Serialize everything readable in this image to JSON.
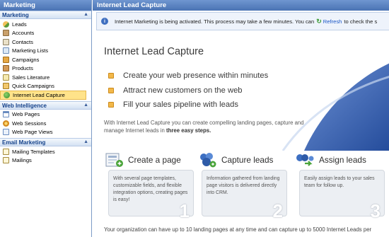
{
  "sidebar": {
    "title": "Marketing",
    "sections": [
      {
        "header": "Marketing",
        "items": [
          {
            "label": "Leads",
            "icon": "leads-icon"
          },
          {
            "label": "Accounts",
            "icon": "accounts-icon"
          },
          {
            "label": "Contacts",
            "icon": "contacts-icon"
          },
          {
            "label": "Marketing Lists",
            "icon": "marketing-lists-icon"
          },
          {
            "label": "Campaigns",
            "icon": "campaigns-icon"
          },
          {
            "label": "Products",
            "icon": "products-icon"
          },
          {
            "label": "Sales Literature",
            "icon": "sales-literature-icon"
          },
          {
            "label": "Quick Campaigns",
            "icon": "quick-campaigns-icon"
          },
          {
            "label": "Internet Lead Capture",
            "icon": "internet-lead-capture-icon",
            "selected": true
          }
        ]
      },
      {
        "header": "Web Intelligence",
        "items": [
          {
            "label": "Web Pages",
            "icon": "web-pages-icon"
          },
          {
            "label": "Web Sessions",
            "icon": "web-sessions-icon"
          },
          {
            "label": "Web Page Views",
            "icon": "web-page-views-icon"
          }
        ]
      },
      {
        "header": "Email Marketing",
        "items": [
          {
            "label": "Mailing Templates",
            "icon": "mailing-templates-icon"
          },
          {
            "label": "Mailings",
            "icon": "mailings-icon"
          }
        ]
      }
    ]
  },
  "main": {
    "title": "Internet Lead Capture",
    "notice": {
      "text_before": "Internet Marketing is being activated. This process may take a few minutes. You can",
      "link": "Refresh",
      "text_after": "to check the s"
    },
    "heading": "Internet Lead Capture",
    "bullets": [
      "Create your web presence within minutes",
      "Attract new customers on the web",
      "Fill your sales pipeline with leads"
    ],
    "intro": {
      "text": "With Internet Lead Capture you can create compelling landing pages, capture and manage Internet leads in",
      "bold": "three easy steps."
    },
    "steps": [
      {
        "title": "Create a page",
        "body": "With several page templates, customizable fields, and flexible integration options, creating pages is easy!",
        "number": "1"
      },
      {
        "title": "Capture leads",
        "body": "Information gathered from landing page visitors is delivered directly into CRM.",
        "number": "2"
      },
      {
        "title": "Assign leads",
        "body": "Easily assign leads to your sales team for follow up.",
        "number": "3"
      }
    ],
    "footer": "Your organization can have up to 10 landing pages at any time and can capture up to 5000 Internet Leads per"
  },
  "colors": {
    "header_blue": "#4a73b3",
    "section_text": "#15428b",
    "selected_bg": "#ffe38a",
    "bullet_orange": "#f2b84a",
    "link_blue": "#1a56c6",
    "swoosh_blue": "#2c55a8"
  }
}
